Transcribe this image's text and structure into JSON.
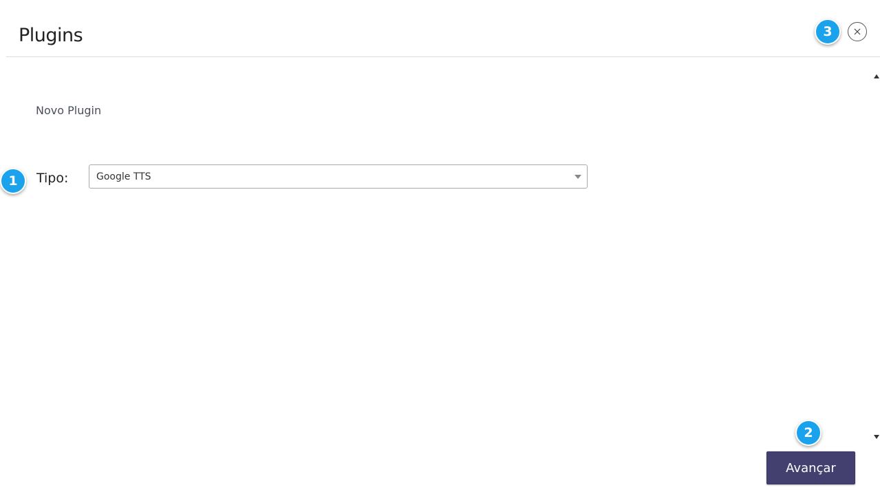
{
  "modal": {
    "title": "Plugins",
    "close_icon": "close-icon"
  },
  "form": {
    "section_title": "Novo Plugin",
    "tipo_label": "Tipo:",
    "tipo_value": "Google TTS"
  },
  "footer": {
    "next_label": "Avançar"
  },
  "badges": {
    "b1": "1",
    "b2": "2",
    "b3": "3"
  },
  "colors": {
    "badge": "#1aa3ec",
    "primary_button": "#433f6e"
  }
}
